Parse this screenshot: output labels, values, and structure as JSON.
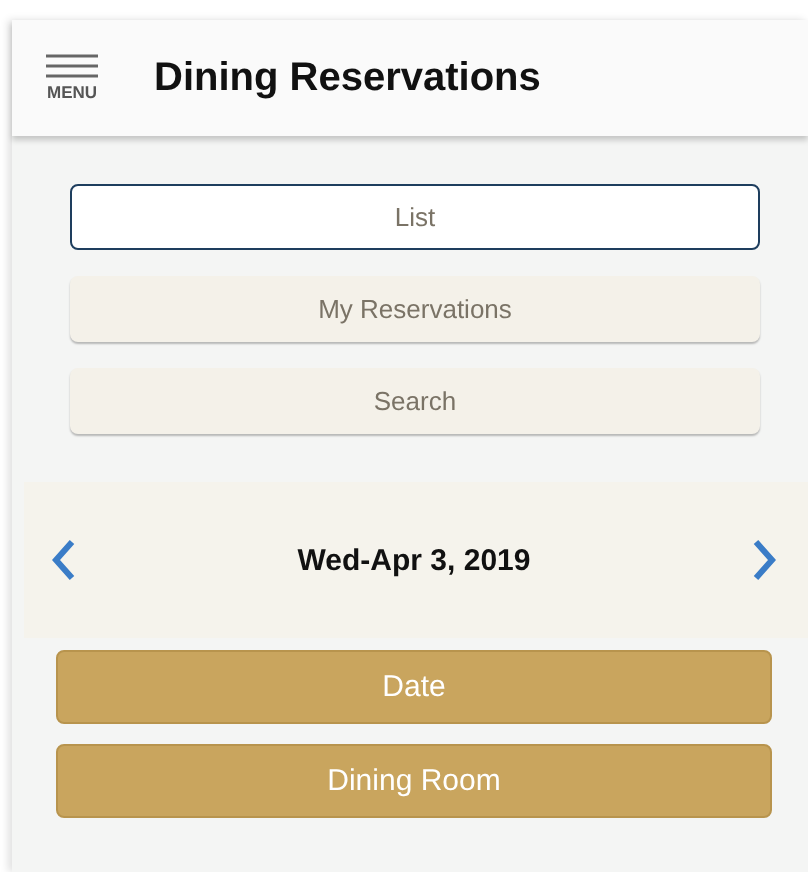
{
  "header": {
    "menu_label": "MENU",
    "title": "Dining Reservations"
  },
  "views": [
    {
      "label": "List",
      "selected": true
    },
    {
      "label": "My Reservations",
      "selected": false
    },
    {
      "label": "Search",
      "selected": false
    }
  ],
  "date_bar": {
    "date": "Wed-Apr 3, 2019"
  },
  "filters": [
    {
      "label": "Date"
    },
    {
      "label": "Dining Room"
    }
  ]
}
